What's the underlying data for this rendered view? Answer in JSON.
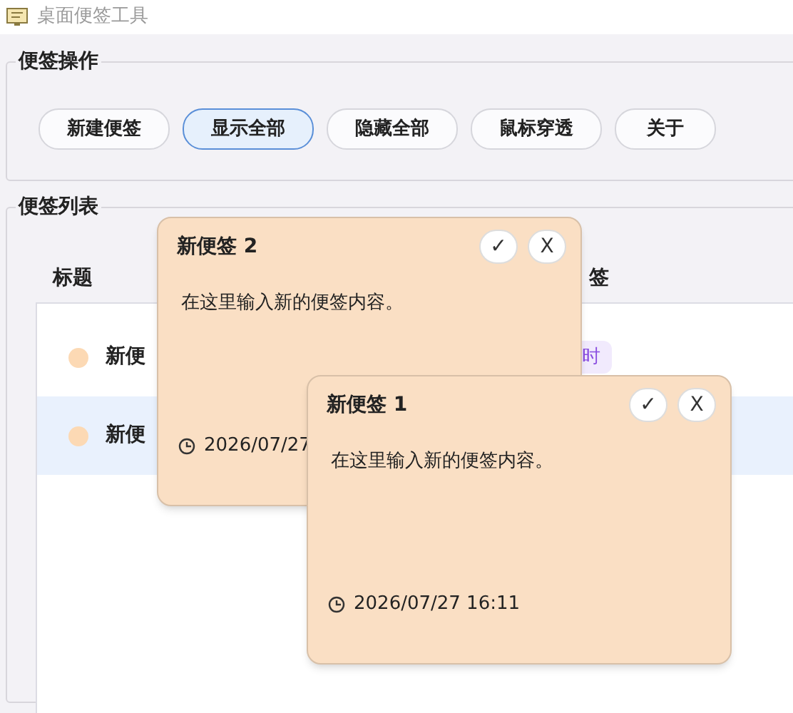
{
  "window": {
    "title": "桌面便签工具"
  },
  "actions": {
    "title": "便签操作",
    "buttons": [
      {
        "label": "新建便签",
        "selected": false
      },
      {
        "label": "显示全部",
        "selected": true
      },
      {
        "label": "隐藏全部",
        "selected": false
      },
      {
        "label": "鼠标穿透",
        "selected": false
      },
      {
        "label": "关于",
        "selected": false
      }
    ]
  },
  "list": {
    "title": "便签列表",
    "columns": [
      "标题",
      "签"
    ],
    "rows": [
      {
        "color": "#fcd9b4",
        "title": "新便",
        "tag": "时",
        "selected": false
      },
      {
        "color": "#fcd9b4",
        "title": "新便",
        "selected": true
      }
    ]
  },
  "notes": [
    {
      "title": "新便签 2",
      "content": "在这里输入新的便签内容。",
      "time": "2026/07/27",
      "confirm": "✓",
      "close": "X"
    },
    {
      "title": "新便签 1",
      "content": "在这里输入新的便签内容。",
      "time": "2026/07/27 16:11",
      "confirm": "✓",
      "close": "X"
    }
  ]
}
